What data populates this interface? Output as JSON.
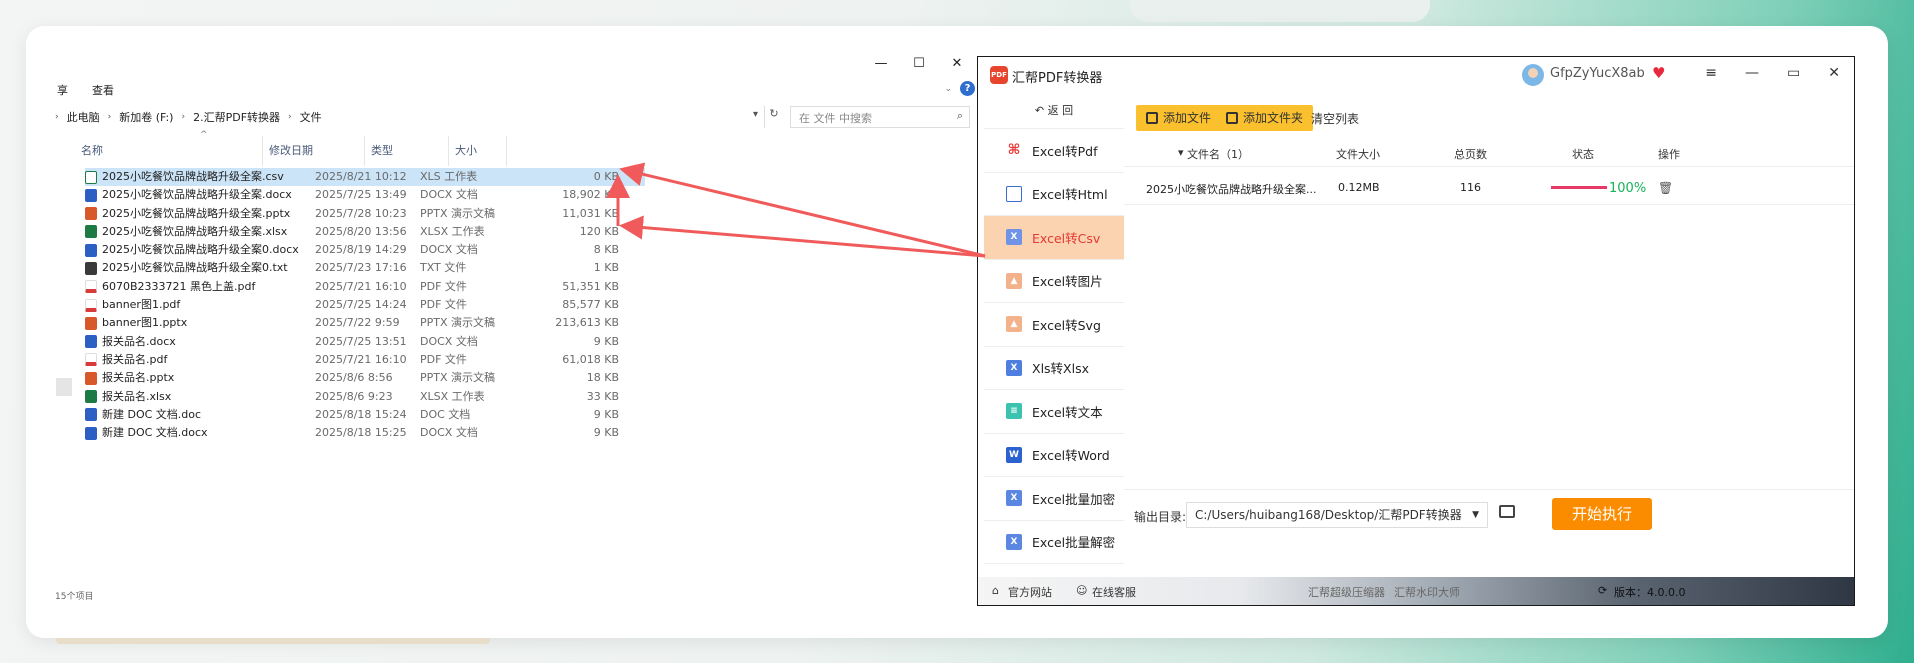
{
  "explorer": {
    "window_controls": [
      "—",
      "☐",
      "✕"
    ],
    "menu": [
      "享",
      "查看"
    ],
    "breadcrumb": [
      "此电脑",
      "新加卷 (F:)",
      "2.汇帮PDF转换器",
      "文件"
    ],
    "search_placeholder": "在 文件 中搜索",
    "columns": [
      "名称",
      "修改日期",
      "类型",
      "大小"
    ],
    "files": [
      {
        "name": "2025小吃餐饮品牌战略升级全案.csv",
        "date": "2025/8/21 10:12",
        "type": "XLS 工作表",
        "size": "0 KB",
        "icon": "csv"
      },
      {
        "name": "2025小吃餐饮品牌战略升级全案.docx",
        "date": "2025/7/25 13:49",
        "type": "DOCX 文档",
        "size": "18,902 KB",
        "icon": "docx"
      },
      {
        "name": "2025小吃餐饮品牌战略升级全案.pptx",
        "date": "2025/7/28 10:23",
        "type": "PPTX 演示文稿",
        "size": "11,031 KB",
        "icon": "pptx"
      },
      {
        "name": "2025小吃餐饮品牌战略升级全案.xlsx",
        "date": "2025/8/20 13:56",
        "type": "XLSX 工作表",
        "size": "120 KB",
        "icon": "xlsx"
      },
      {
        "name": "2025小吃餐饮品牌战略升级全案0.docx",
        "date": "2025/8/19 14:29",
        "type": "DOCX 文档",
        "size": "8 KB",
        "icon": "docx"
      },
      {
        "name": "2025小吃餐饮品牌战略升级全案0.txt",
        "date": "2025/7/23 17:16",
        "type": "TXT 文件",
        "size": "1 KB",
        "icon": "txt"
      },
      {
        "name": "6070B2333721 黑色上盖.pdf",
        "date": "2025/7/21 16:10",
        "type": "PDF 文件",
        "size": "51,351 KB",
        "icon": "pdf"
      },
      {
        "name": "banner图1.pdf",
        "date": "2025/7/25 14:24",
        "type": "PDF 文件",
        "size": "85,577 KB",
        "icon": "pdf"
      },
      {
        "name": "banner图1.pptx",
        "date": "2025/7/22 9:59",
        "type": "PPTX 演示文稿",
        "size": "213,613 KB",
        "icon": "pptx"
      },
      {
        "name": "报关品名.docx",
        "date": "2025/7/25 13:51",
        "type": "DOCX 文档",
        "size": "9 KB",
        "icon": "docx"
      },
      {
        "name": "报关品名.pdf",
        "date": "2025/7/21 16:10",
        "type": "PDF 文件",
        "size": "61,018 KB",
        "icon": "pdf"
      },
      {
        "name": "报关品名.pptx",
        "date": "2025/8/6 8:56",
        "type": "PPTX 演示文稿",
        "size": "18 KB",
        "icon": "pptx"
      },
      {
        "name": "报关品名.xlsx",
        "date": "2025/8/6 9:23",
        "type": "XLSX 工作表",
        "size": "33 KB",
        "icon": "xlsx"
      },
      {
        "name": "新建 DOC 文档.doc",
        "date": "2025/8/18 15:24",
        "type": "DOC 文档",
        "size": "9 KB",
        "icon": "doc"
      },
      {
        "name": "新建 DOC 文档.docx",
        "date": "2025/8/18 15:25",
        "type": "DOCX 文档",
        "size": "9 KB",
        "icon": "docx"
      }
    ],
    "status": "15个项目"
  },
  "app": {
    "title": "汇帮PDF转换器",
    "logo_text": "PDF",
    "user": "GfpZyYucX8ab",
    "back_label": "返 回",
    "sidebar": [
      {
        "label": "Excel转Pdf",
        "icon": "pdf"
      },
      {
        "label": "Excel转Html",
        "icon": "html"
      },
      {
        "label": "Excel转Csv",
        "icon": "csv",
        "active": true
      },
      {
        "label": "Excel转图片",
        "icon": "img"
      },
      {
        "label": "Excel转Svg",
        "icon": "img"
      },
      {
        "label": "Xls转Xlsx",
        "icon": "x"
      },
      {
        "label": "Excel转文本",
        "icon": "txt"
      },
      {
        "label": "Excel转Word",
        "icon": "word"
      },
      {
        "label": "Excel批量加密",
        "icon": "lock"
      },
      {
        "label": "Excel批量解密",
        "icon": "lock"
      }
    ],
    "toolbar": {
      "add_file": "添加文件",
      "add_folder": "添加文件夹",
      "clear": "清空列表"
    },
    "table": {
      "headers": [
        "文件名（1）",
        "文件大小",
        "总页数",
        "状态",
        "操作"
      ],
      "row": {
        "name": "2025小吃餐饮品牌战略升级全案...",
        "size": "0.12MB",
        "pages": "116",
        "progress": 1.0,
        "progress_text": "100%"
      }
    },
    "output": {
      "label": "输出目录:",
      "path": "C:/Users/huibang168/Desktop/汇帮PDF转换器"
    },
    "start_label": "开始执行",
    "footer": {
      "site": "官方网站",
      "service": "在线客服",
      "link1": "汇帮超级压缩器",
      "link2": "汇帮水印大师",
      "version": "版本：4.0.0.0"
    },
    "accent": "#fbc02d",
    "start_color": "#fb8c00",
    "active_bg": "#fbd3b0"
  }
}
